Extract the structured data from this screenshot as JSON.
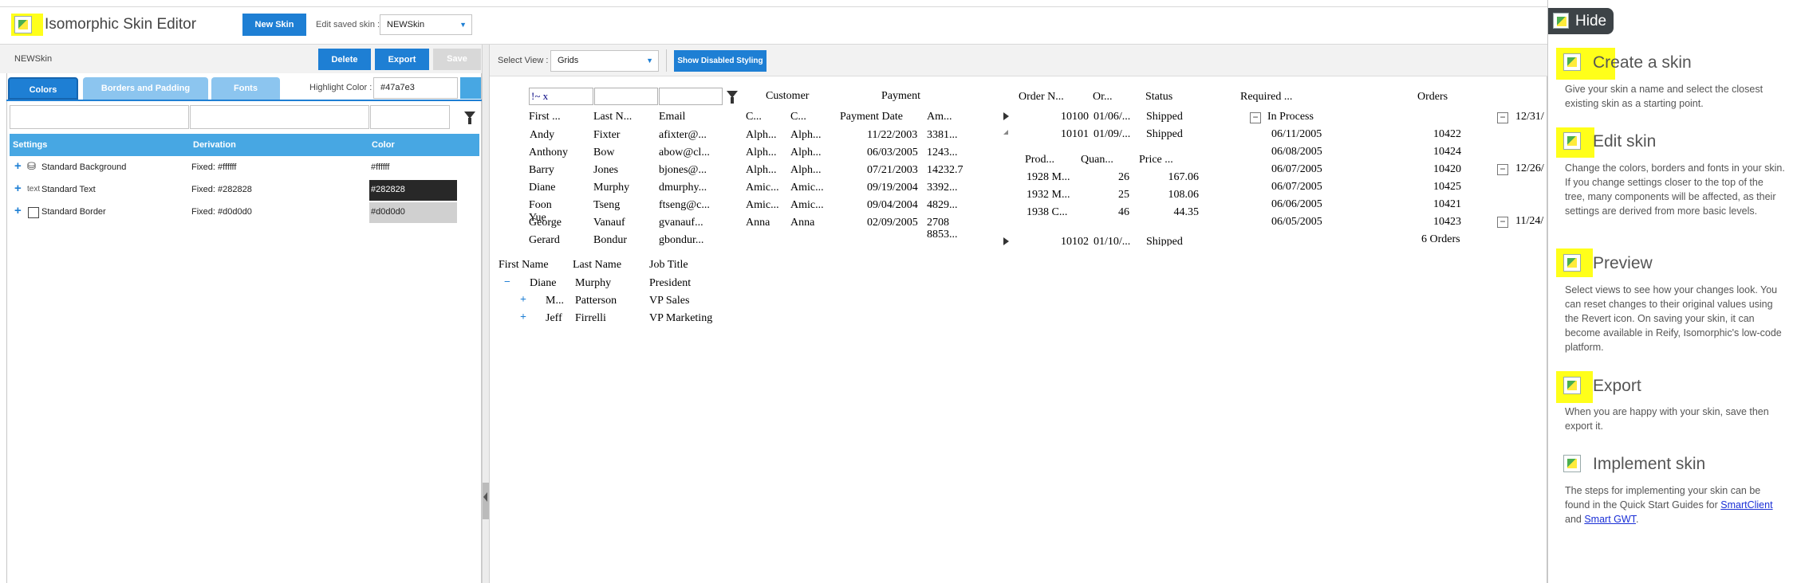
{
  "header": {
    "app_title": "Isomorphic Skin Editor",
    "new_skin_label": "New Skin",
    "edit_saved_label": "Edit saved skin :",
    "saved_skin_value": "NEWSkin"
  },
  "left_panel": {
    "skin_name": "NEWSkin",
    "delete_label": "Delete",
    "export_label": "Export",
    "save_label": "Save",
    "tabs": [
      "Colors",
      "Borders and Padding",
      "Fonts"
    ],
    "highlight_label": "Highlight Color :",
    "highlight_value": "#47a7e3",
    "columns": [
      "Settings",
      "Derivation",
      "Color"
    ],
    "rows": [
      {
        "setting": "Standard Background",
        "derivation": "Fixed: #ffffff",
        "color": "#ffffff"
      },
      {
        "setting": "Standard Text",
        "prefix": "text",
        "derivation": "Fixed: #282828",
        "color": "#282828"
      },
      {
        "setting": "Standard Border",
        "derivation": "Fixed: #d0d0d0",
        "color": "#d0d0d0"
      }
    ]
  },
  "preview": {
    "select_view_label": "Select View :",
    "view_value": "Grids",
    "show_disabled_label": "Show Disabled Styling",
    "grid1": {
      "filter_value": "!~ x",
      "group_headers": [
        "Customer",
        "Payment"
      ],
      "columns": [
        "First ...",
        "Last N...",
        "Email",
        "C...",
        "C...",
        "Payment Date",
        "Am..."
      ],
      "rows": [
        [
          "Andy",
          "Fixter",
          "afixter@...",
          "Alph...",
          "Alph...",
          "11/22/2003",
          "3381..."
        ],
        [
          "Anthony",
          "Bow",
          "abow@cl...",
          "Alph...",
          "Alph...",
          "06/03/2005",
          "1243..."
        ],
        [
          "Barry",
          "Jones",
          "bjones@...",
          "Alph...",
          "Alph...",
          "07/21/2003",
          "14232.7"
        ],
        [
          "Diane",
          "Murphy",
          "dmurphy...",
          "Amic...",
          "Amic...",
          "09/19/2004",
          "3392..."
        ],
        [
          "Foon Yue",
          "Tseng",
          "ftseng@c...",
          "Amic...",
          "Amic...",
          "09/04/2004",
          "4829..."
        ],
        [
          "George",
          "Vanauf",
          "gvanauf...",
          "Anna",
          "Anna",
          "02/09/2005",
          "2708"
        ],
        [
          "Gerard",
          "Bondur",
          "gbondur...",
          "",
          "",
          "",
          ""
        ]
      ],
      "total": "8853..."
    },
    "tree": {
      "columns": [
        "First Name",
        "Last Name",
        "Job Title"
      ],
      "rows": [
        {
          "sign": "−",
          "first": "Diane",
          "last": "Murphy",
          "title": "President"
        },
        {
          "sign": "+",
          "first": "M...",
          "last": "Patterson",
          "title": "VP Sales"
        },
        {
          "sign": "+",
          "first": "Jeff",
          "last": "Firrelli",
          "title": "VP Marketing"
        }
      ]
    },
    "grid2": {
      "columns": [
        "Order N...",
        "Or...",
        "Status"
      ],
      "orders": [
        {
          "num": "10100",
          "date": "01/06/...",
          "status": "Shipped"
        },
        {
          "num": "10101",
          "date": "01/09/...",
          "status": "Shipped"
        },
        {
          "num": "10102",
          "date": "01/10/...",
          "status": "Shipped"
        }
      ],
      "sub_columns": [
        "Prod...",
        "Quan...",
        "Price ..."
      ],
      "sub_rows": [
        {
          "prod": "1928 M...",
          "qty": "26",
          "price": "167.06"
        },
        {
          "prod": "1932 M...",
          "qty": "25",
          "price": "108.06"
        },
        {
          "prod": "1938 C...",
          "qty": "46",
          "price": "44.35"
        }
      ]
    },
    "grid3": {
      "columns": [
        "Required ...",
        "Orders"
      ],
      "group": "In Process",
      "rows": [
        {
          "date": "06/11/2005",
          "order": "10422"
        },
        {
          "date": "06/08/2005",
          "order": "10424"
        },
        {
          "date": "06/07/2005",
          "order": "10420"
        },
        {
          "date": "06/07/2005",
          "order": "10425"
        },
        {
          "date": "06/06/2005",
          "order": "10421"
        },
        {
          "date": "06/05/2005",
          "order": "10423"
        }
      ],
      "summary": "6 Orders"
    },
    "grid4": {
      "dates": [
        "12/31/",
        "12/26/",
        "11/24/"
      ]
    }
  },
  "sidebar": {
    "hide_label": "Hide",
    "sections": [
      {
        "title": "Create a skin",
        "text": "Give your skin a name and select the closest existing skin as a starting point."
      },
      {
        "title": "Edit skin",
        "text": "Change the colors, borders and fonts in your skin. If you change settings closer to the top of the tree, many components will be affected, as their settings are derived from more basic levels."
      },
      {
        "title": "Preview",
        "text": "Select views to see how your changes look. You can reset changes to their original values using the Revert icon. On saving your skin, it can become available in Reify, Isomorphic's low-code platform."
      },
      {
        "title": "Export",
        "text": "When you are happy with your skin, save then export it."
      },
      {
        "title": "Implement skin",
        "text": "The steps for implementing your skin can be found in the Quick Start Guides for",
        "link1": "SmartClient",
        "joiner": "and",
        "link2": "Smart GWT",
        "end": "."
      }
    ]
  }
}
